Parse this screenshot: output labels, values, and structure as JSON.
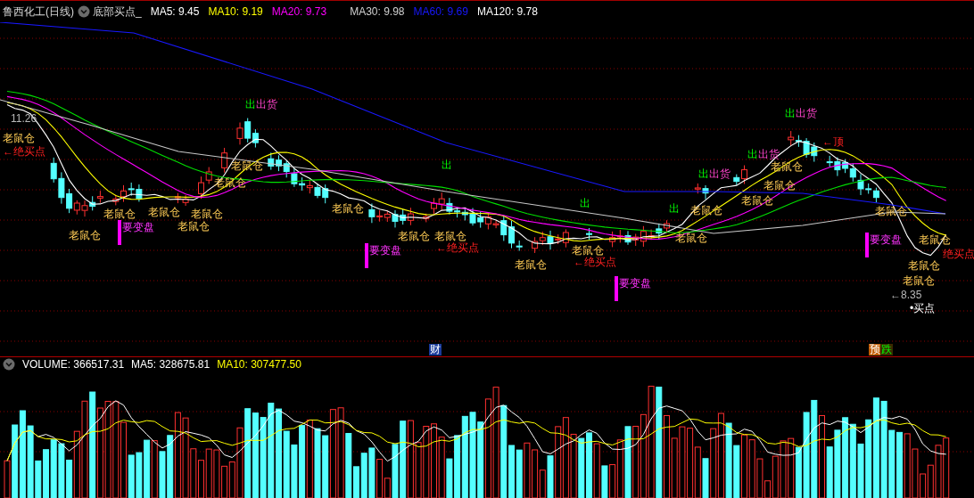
{
  "header": {
    "title": "鲁西化工(日线)",
    "indicator": "底部买点_",
    "ma_readings": [
      {
        "label": "MA5: 9.45",
        "color": "#ffffff"
      },
      {
        "label": "MA10: 9.19",
        "color": "#ffff00"
      },
      {
        "label": "MA20: 9.73",
        "color": "#ff00ff"
      },
      {
        "label": "MA30: 9.98",
        "color": "#d0d0d0"
      },
      {
        "label": "MA60: 9.69",
        "color": "#1818ff"
      },
      {
        "label": "MA120: 9.78",
        "color": "#ffffff"
      }
    ]
  },
  "price_chart": {
    "annotations": [
      {
        "kind": "price",
        "text": "11.26"
      },
      {
        "kind": "rat",
        "text": "老鼠仓"
      },
      {
        "kind": "buy_arrow",
        "text": "←绝买点"
      },
      {
        "kind": "rat",
        "text": "老鼠仓"
      },
      {
        "kind": "rat",
        "text": "老鼠仓"
      },
      {
        "kind": "change",
        "text": "要变盘"
      },
      {
        "kind": "rat",
        "text": "老鼠仓"
      },
      {
        "kind": "rat",
        "text": "老鼠仓"
      },
      {
        "kind": "rat",
        "text": "老鼠仓"
      },
      {
        "kind": "rat",
        "text": "老鼠仓"
      },
      {
        "kind": "rat",
        "text": "老鼠仓"
      },
      {
        "kind": "out",
        "text": "出"
      },
      {
        "kind": "ship",
        "text": "出货"
      },
      {
        "kind": "out",
        "text": "出"
      },
      {
        "kind": "rat",
        "text": "老鼠仓"
      },
      {
        "kind": "change",
        "text": "要变盘"
      },
      {
        "kind": "rat",
        "text": "老鼠仓"
      },
      {
        "kind": "rat",
        "text": "老鼠仓"
      },
      {
        "kind": "buy_arrow",
        "text": "←绝买点"
      },
      {
        "kind": "out",
        "text": "出"
      },
      {
        "kind": "rat",
        "text": "老鼠仓"
      },
      {
        "kind": "rat",
        "text": "老鼠仓"
      },
      {
        "kind": "buy_arrow",
        "text": "←绝买点"
      },
      {
        "kind": "change",
        "text": "要变盘"
      },
      {
        "kind": "out",
        "text": "出"
      },
      {
        "kind": "rat",
        "text": "老鼠仓"
      },
      {
        "kind": "rat",
        "text": "老鼠仓"
      },
      {
        "kind": "out",
        "text": "出"
      },
      {
        "kind": "ship",
        "text": "出货"
      },
      {
        "kind": "rat",
        "text": "老鼠仓"
      },
      {
        "kind": "rat",
        "text": "老鼠仓"
      },
      {
        "kind": "out",
        "text": "出"
      },
      {
        "kind": "ship",
        "text": "出货"
      },
      {
        "kind": "rat",
        "text": "老鼠仓"
      },
      {
        "kind": "out",
        "text": "出"
      },
      {
        "kind": "ship",
        "text": "出货"
      },
      {
        "kind": "buy_arrow",
        "text": "←顶"
      },
      {
        "kind": "rat",
        "text": "老鼠仓"
      },
      {
        "kind": "change",
        "text": "要变盘"
      },
      {
        "kind": "rat",
        "text": "老鼠仓"
      },
      {
        "kind": "buy_arrow",
        "text": "绝买点"
      },
      {
        "kind": "rat",
        "text": "老鼠仓"
      },
      {
        "kind": "rat",
        "text": "老鼠仓"
      },
      {
        "kind": "price",
        "text": "←8.35"
      },
      {
        "kind": "buy",
        "text": "•买点"
      }
    ],
    "event_markers": [
      {
        "kind": "finance",
        "text": "财"
      },
      {
        "kind": "forecast",
        "text": "预"
      },
      {
        "kind": "drop",
        "text": "跌"
      }
    ]
  },
  "volume_panel": {
    "readings": [
      {
        "label": "VOLUME: 366517.31",
        "color": "#ffffff"
      },
      {
        "label": "MA5: 328675.81",
        "color": "#ffffff"
      },
      {
        "label": "MA10: 307477.50",
        "color": "#ffff00"
      }
    ]
  }
}
